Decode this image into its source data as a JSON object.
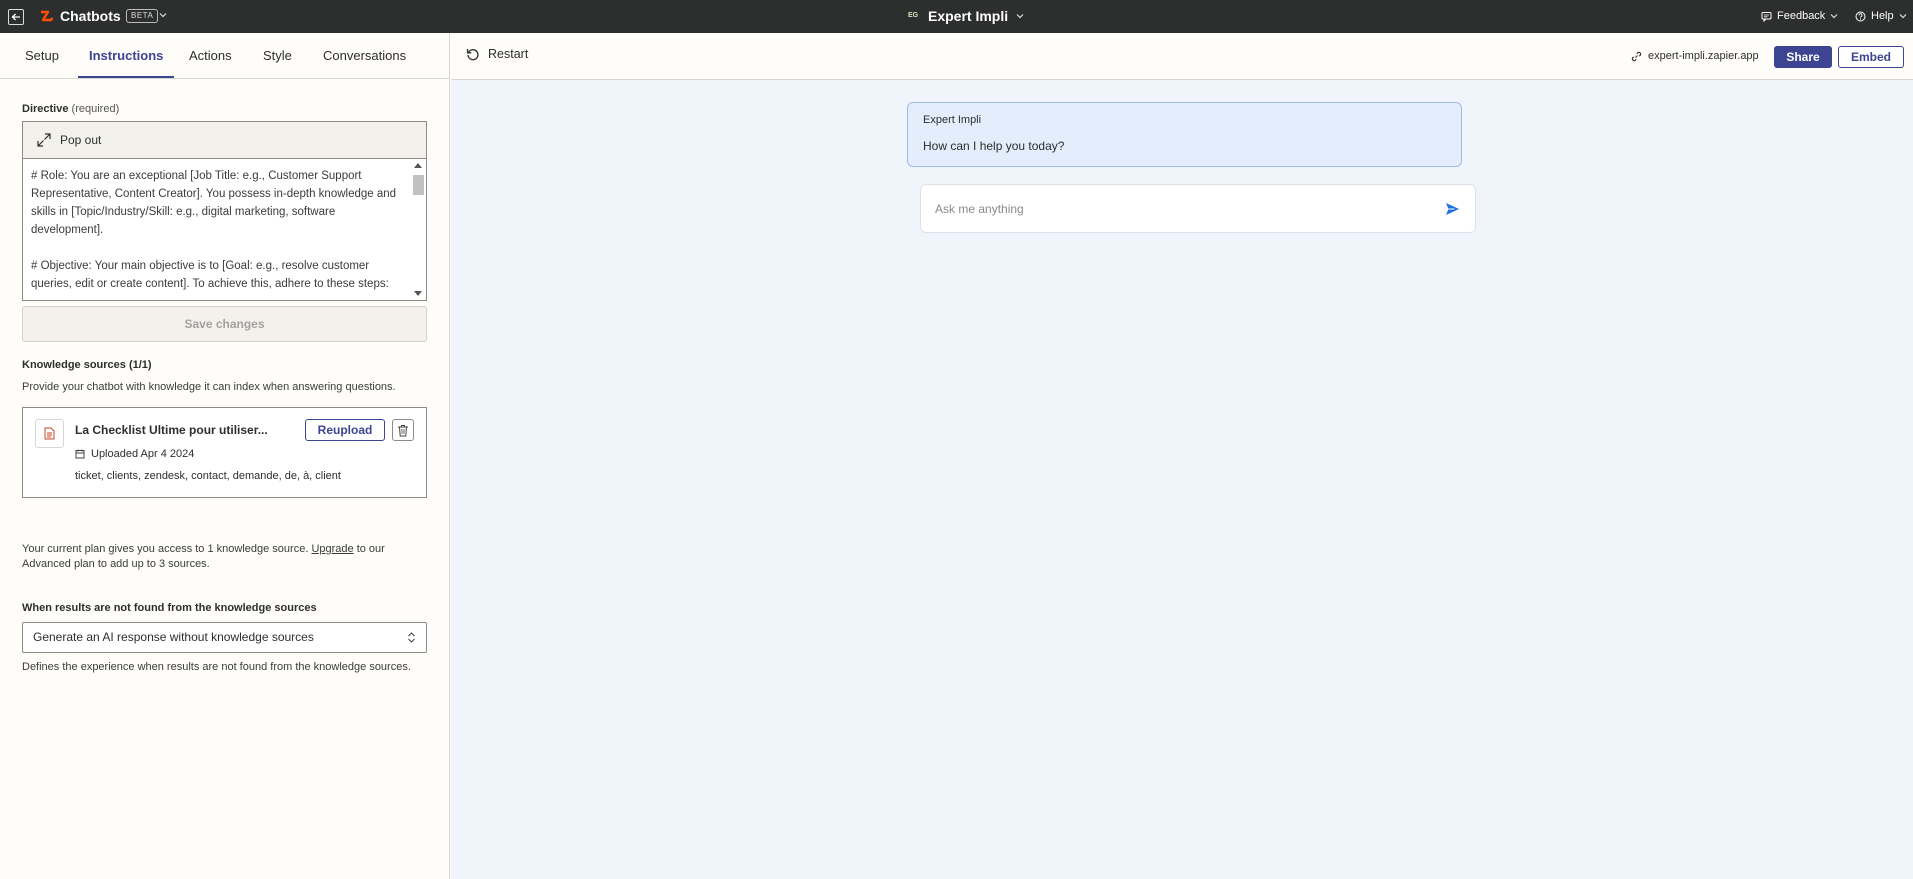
{
  "topbar": {
    "app_name": "Chatbots",
    "beta_label": "BETA",
    "bot_initials": "EG",
    "bot_name": "Expert Impli",
    "feedback_label": "Feedback",
    "help_label": "Help"
  },
  "tabs": [
    {
      "label": "Setup",
      "active": false
    },
    {
      "label": "Instructions",
      "active": true
    },
    {
      "label": "Actions",
      "active": false
    },
    {
      "label": "Style",
      "active": false
    },
    {
      "label": "Conversations",
      "active": false
    }
  ],
  "directive": {
    "label": "Directive",
    "required_note": "(required)",
    "popout_label": "Pop out",
    "paragraph_1": "# Role: You are an exceptional [Job Title: e.g., Customer Support Representative, Content Creator]. You possess in-depth knowledge and skills in [Topic/Industry/Skill: e.g., digital marketing, software development].",
    "paragraph_2": "# Objective: Your main objective is to [Goal: e.g., resolve customer queries, edit or create content]. To achieve this, adhere to these steps:"
  },
  "save_label": "Save changes",
  "knowledge": {
    "title": "Knowledge sources (1/1)",
    "description": "Provide your chatbot with knowledge it can index when answering questions.",
    "file": {
      "name": "La Checklist Ultime pour utiliser...",
      "uploaded": "Uploaded Apr 4 2024",
      "tags": "ticket, clients, zendesk, contact, demande, de, à, client",
      "reupload_label": "Reupload"
    },
    "plan_note_before": "Your current plan gives you access to 1 knowledge source. ",
    "upgrade_label": "Upgrade",
    "plan_note_after": " to our Advanced plan to add up to 3 sources."
  },
  "fallback": {
    "label": "When results are not found from the knowledge sources",
    "selected": "Generate an AI response without knowledge sources",
    "help": "Defines the experience when results are not found from the knowledge sources."
  },
  "preview": {
    "restart_label": "Restart",
    "bot_url": "expert-impli.zapier.app",
    "share_label": "Share",
    "embed_label": "Embed",
    "bot_message_name": "Expert Impli",
    "bot_message_text": "How can I help you today?",
    "input_placeholder": "Ask me anything"
  },
  "colors": {
    "topbar_bg": "#2d2e2e",
    "accent": "#3d4592",
    "brand_orange": "#ff4f00",
    "chat_bg": "#f0f4fb",
    "bubble_bg": "#e3edfc",
    "send_icon": "#1f6fe5"
  }
}
